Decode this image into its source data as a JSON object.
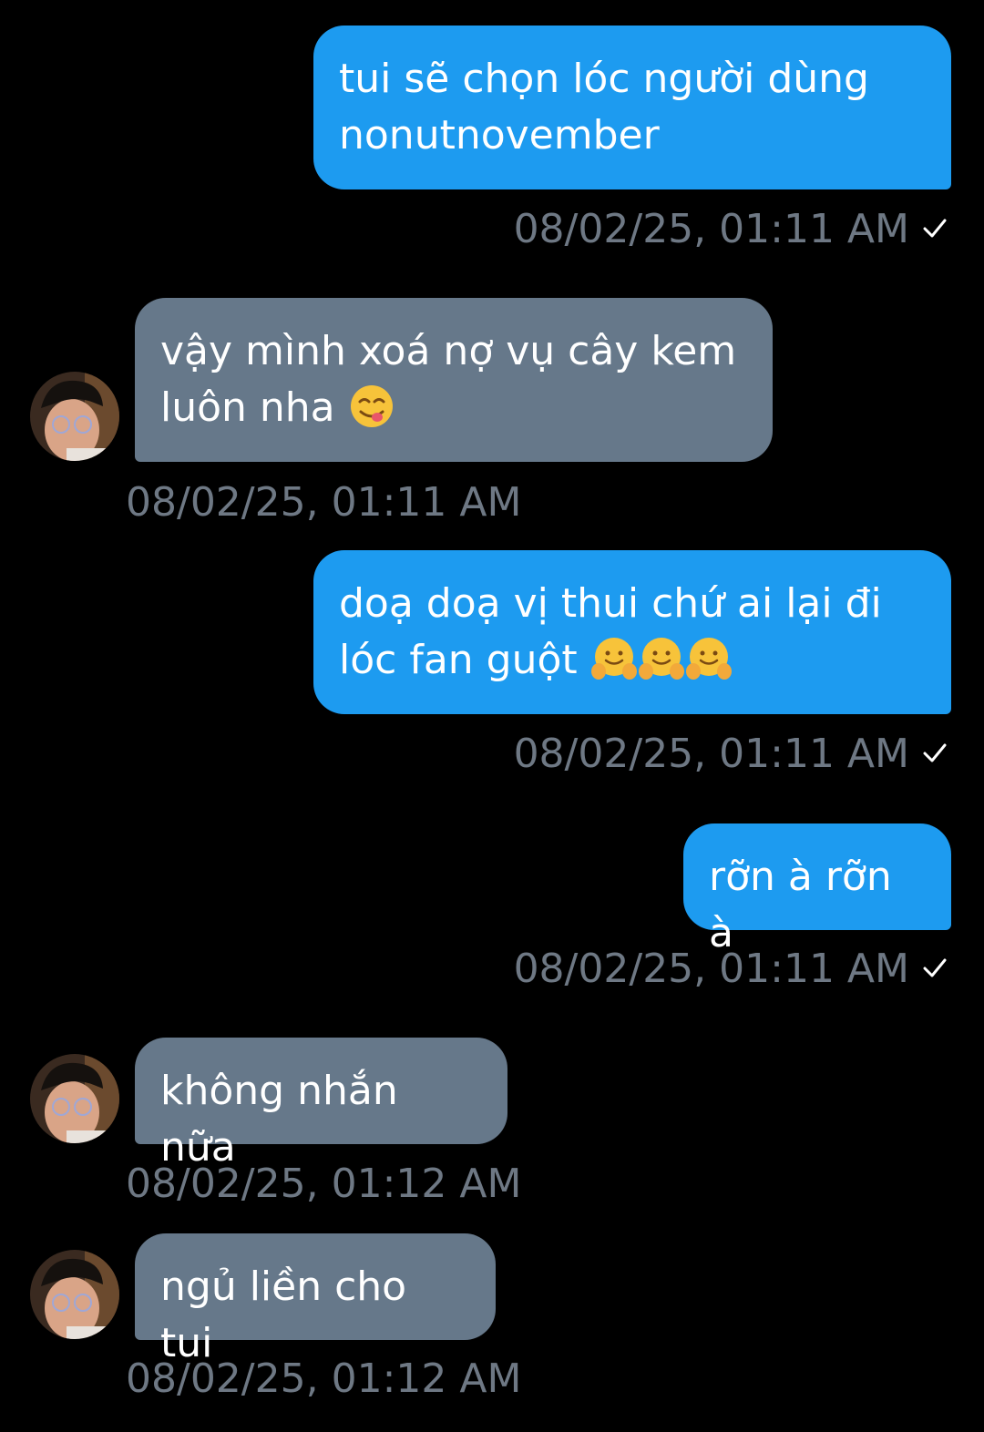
{
  "messages": [
    {
      "direction": "out",
      "text": "tui sẽ chọn lóc người dùng nonutnovember",
      "timestamp": "08/02/25, 01:11 AM",
      "read": true
    },
    {
      "direction": "in",
      "text": "vậy mình xoá nợ vụ cây kem luôn nha",
      "emoji": [
        "yum-emoji"
      ],
      "timestamp": "08/02/25, 01:11 AM"
    },
    {
      "direction": "out",
      "text": "doạ doạ vị thui chứ ai lại đi lóc fan guột",
      "emoji": [
        "hugging-emoji",
        "hugging-emoji",
        "hugging-emoji"
      ],
      "timestamp": "08/02/25, 01:11 AM",
      "read": true
    },
    {
      "direction": "out",
      "text": "rỡn à rỡn à",
      "timestamp": "08/02/25, 01:11 AM",
      "read": true
    },
    {
      "direction": "in",
      "text": "không nhắn nữa",
      "timestamp": "08/02/25, 01:12 AM"
    },
    {
      "direction": "in",
      "text": "ngủ liền cho tui",
      "timestamp": "08/02/25, 01:12 AM"
    }
  ],
  "colors": {
    "background": "#000000",
    "outgoing_bubble": "#1d9bf0",
    "incoming_bubble": "#66788a",
    "timestamp": "#6e7884",
    "text": "#ffffff"
  },
  "icons": {
    "read_receipt": "checkmark-icon",
    "avatar": "contact-avatar"
  }
}
